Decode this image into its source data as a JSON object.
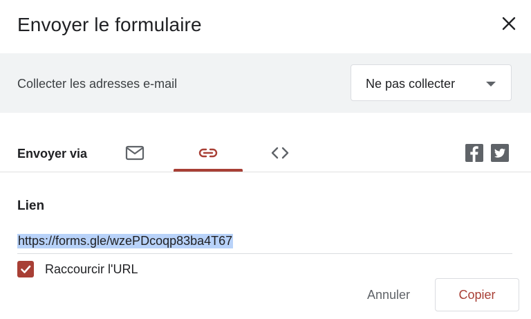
{
  "dialog": {
    "title": "Envoyer le formulaire",
    "close_icon": "close-icon"
  },
  "collect": {
    "label": "Collecter les adresses e-mail",
    "selected": "Ne pas collecter"
  },
  "send": {
    "label": "Envoyer via",
    "tabs": [
      {
        "icon": "mail-icon",
        "active": false
      },
      {
        "icon": "link-icon",
        "active": true
      },
      {
        "icon": "embed-code-icon",
        "active": false
      }
    ],
    "social": [
      {
        "icon": "facebook-icon"
      },
      {
        "icon": "twitter-icon"
      }
    ]
  },
  "link_section": {
    "title": "Lien",
    "url": "https://forms.gle/wzePDcoqp83ba4T67",
    "shorten_label": "Raccourcir l'URL",
    "shorten_checked": true
  },
  "actions": {
    "cancel": "Annuler",
    "copy": "Copier"
  },
  "colors": {
    "accent": "#a83f35",
    "selection": "#b8d2f9",
    "band": "#f1f3f4"
  }
}
